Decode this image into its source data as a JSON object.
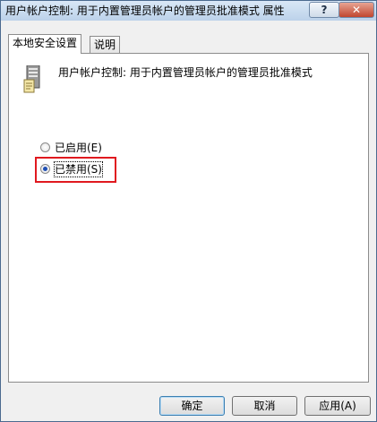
{
  "window": {
    "title": "用户帐户控制: 用于内置管理员帐户的管理员批准模式 属性",
    "help_label": "?",
    "close_label": "✕"
  },
  "tabs": [
    {
      "label": "本地安全设置",
      "active": true
    },
    {
      "label": "说明",
      "active": false
    }
  ],
  "policy": {
    "icon": "server-policy-icon",
    "title": "用户帐户控制: 用于内置管理员帐户的管理员批准模式"
  },
  "options": [
    {
      "label": "已启用(E)",
      "checked": false
    },
    {
      "label": "已禁用(S)",
      "checked": true
    }
  ],
  "buttons": {
    "ok": "确定",
    "cancel": "取消",
    "apply": "应用(A)"
  },
  "colors": {
    "highlight": "#e0191f",
    "radio_dot": "#1f4fb5"
  }
}
